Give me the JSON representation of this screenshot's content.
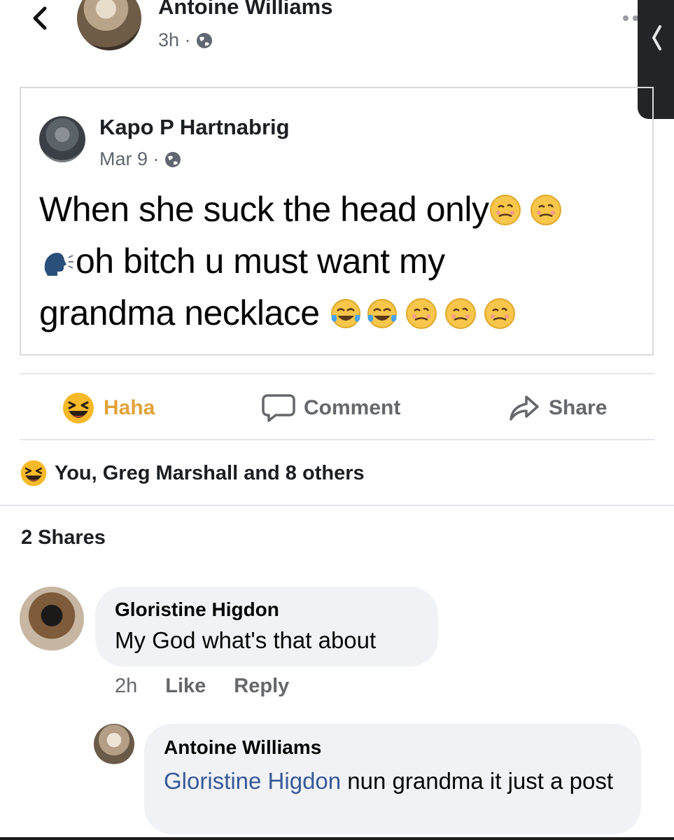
{
  "header": {
    "author": "Antoine Williams",
    "time": "3h ·",
    "privacy_icon": "globe-icon"
  },
  "shared_post": {
    "author": "Kapo P Hartnabrig",
    "date": "Mar 9 ·",
    "text_line1": "When she suck the head only",
    "text_line2": "oh bitch u must want my",
    "text_line3": "grandma necklace "
  },
  "actions": {
    "haha": "Haha",
    "comment": "Comment",
    "share": "Share"
  },
  "reactions": {
    "summary": "You, Greg Marshall and 8 others",
    "icon": "haha-icon"
  },
  "shares": "2 Shares",
  "comments": [
    {
      "author": "Gloristine Higdon",
      "text": "My God what's that about",
      "time": "2h",
      "like": "Like",
      "reply": "Reply"
    }
  ],
  "reply": {
    "author": "Antoine Williams",
    "mention": "Gloristine Higdon",
    "text": " nun grandma it just a post"
  },
  "colors": {
    "accent_link": "#385898",
    "haha_yellow": "#f7b928",
    "muted": "#65676b",
    "bubble": "#f0f2f5"
  }
}
